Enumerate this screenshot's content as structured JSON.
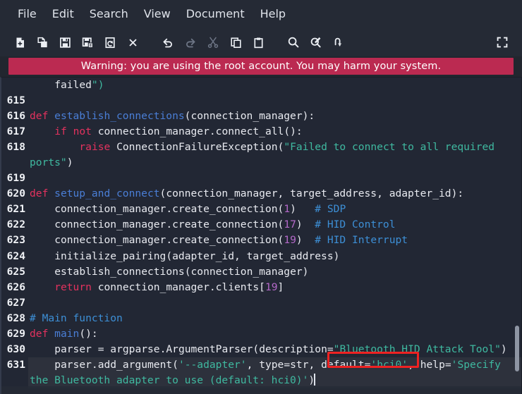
{
  "window": {
    "background": "#22262f",
    "accent_warning": "#bb2a51",
    "annotation_color": "#ee2222"
  },
  "menubar": {
    "items": [
      {
        "label": "File",
        "name": "menu-file"
      },
      {
        "label": "Edit",
        "name": "menu-edit"
      },
      {
        "label": "Search",
        "name": "menu-search"
      },
      {
        "label": "View",
        "name": "menu-view"
      },
      {
        "label": "Document",
        "name": "menu-document"
      },
      {
        "label": "Help",
        "name": "menu-help"
      }
    ]
  },
  "toolbar": {
    "buttons": [
      {
        "icon": "new-file-icon",
        "label": "New",
        "enabled": true
      },
      {
        "icon": "open-file-icon",
        "label": "Open",
        "enabled": true
      },
      {
        "icon": "save-icon",
        "label": "Save",
        "enabled": true
      },
      {
        "icon": "save-as-icon",
        "label": "Save As",
        "enabled": true
      },
      {
        "icon": "revert-icon",
        "label": "Revert",
        "enabled": true
      },
      {
        "icon": "close-icon",
        "label": "Close",
        "enabled": true
      },
      {
        "icon": "undo-icon",
        "label": "Undo",
        "enabled": true
      },
      {
        "icon": "redo-icon",
        "label": "Redo",
        "enabled": false
      },
      {
        "icon": "cut-icon",
        "label": "Cut",
        "enabled": false
      },
      {
        "icon": "copy-icon",
        "label": "Copy",
        "enabled": true
      },
      {
        "icon": "paste-icon",
        "label": "Paste",
        "enabled": true
      },
      {
        "icon": "search-icon",
        "label": "Find",
        "enabled": true
      },
      {
        "icon": "find-replace-icon",
        "label": "Find and Replace",
        "enabled": true
      },
      {
        "icon": "goto-line-icon",
        "label": "Go to Line",
        "enabled": true
      },
      {
        "icon": "fullscreen-icon",
        "label": "Fullscreen",
        "enabled": true
      }
    ]
  },
  "banner": {
    "text": "Warning: you are using the root account. You may harm your system."
  },
  "editor": {
    "language": "python",
    "current_line": 631,
    "first_visible_line_partial": "    failed\")",
    "lines": [
      {
        "number": "",
        "continuation": true,
        "text": "    failed\")"
      },
      {
        "number": "615",
        "continuation": false,
        "text": ""
      },
      {
        "number": "616",
        "continuation": false,
        "text": "def establish_connections(connection_manager):"
      },
      {
        "number": "617",
        "continuation": false,
        "text": "    if not connection_manager.connect_all():"
      },
      {
        "number": "618",
        "continuation": false,
        "text": "        raise ConnectionFailureException(\"Failed to connect to all required ports\")"
      },
      {
        "number": "619",
        "continuation": false,
        "text": ""
      },
      {
        "number": "620",
        "continuation": false,
        "text": "def setup_and_connect(connection_manager, target_address, adapter_id):"
      },
      {
        "number": "621",
        "continuation": false,
        "text": "    connection_manager.create_connection(1)   # SDP"
      },
      {
        "number": "622",
        "continuation": false,
        "text": "    connection_manager.create_connection(17)  # HID Control"
      },
      {
        "number": "623",
        "continuation": false,
        "text": "    connection_manager.create_connection(19)  # HID Interrupt"
      },
      {
        "number": "624",
        "continuation": false,
        "text": "    initialize_pairing(adapter_id, target_address)"
      },
      {
        "number": "625",
        "continuation": false,
        "text": "    establish_connections(connection_manager)"
      },
      {
        "number": "626",
        "continuation": false,
        "text": "    return connection_manager.clients[19]"
      },
      {
        "number": "627",
        "continuation": false,
        "text": ""
      },
      {
        "number": "628",
        "continuation": false,
        "text": "# Main function"
      },
      {
        "number": "629",
        "continuation": false,
        "text": "def main():"
      },
      {
        "number": "630",
        "continuation": false,
        "text": "    parser = argparse.ArgumentParser(description=\"Bluetooth HID Attack Tool\")"
      },
      {
        "number": "631",
        "continuation": false,
        "text": "    parser.add_argument('--adapter', type=str, default='hci0', help='Specify the Bluetooth adapter to use (default: hci0)')"
      }
    ],
    "annotation": {
      "target_text": "default='hci0',",
      "color": "#ee2222"
    }
  }
}
